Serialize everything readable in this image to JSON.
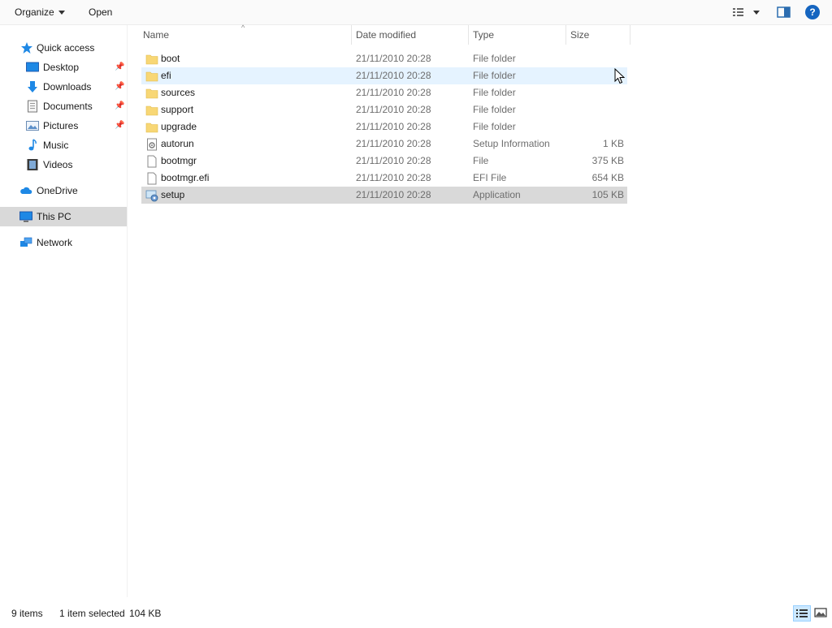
{
  "toolbar": {
    "organize": "Organize",
    "open": "Open",
    "help": "?"
  },
  "nav": {
    "quick_access": "Quick access",
    "items": [
      {
        "label": "Desktop",
        "icon": "desktop-icon",
        "pinned": true
      },
      {
        "label": "Downloads",
        "icon": "downloads-icon",
        "pinned": true
      },
      {
        "label": "Documents",
        "icon": "documents-icon",
        "pinned": true
      },
      {
        "label": "Pictures",
        "icon": "pictures-icon",
        "pinned": true
      },
      {
        "label": "Music",
        "icon": "music-icon",
        "pinned": false
      },
      {
        "label": "Videos",
        "icon": "videos-icon",
        "pinned": false
      }
    ],
    "onedrive": "OneDrive",
    "this_pc": "This PC",
    "network": "Network"
  },
  "columns": {
    "name": "Name",
    "date": "Date modified",
    "type": "Type",
    "size": "Size"
  },
  "files": [
    {
      "name": "boot",
      "date": "21/11/2010 20:28",
      "type": "File folder",
      "size": "",
      "icon": "folder-icon"
    },
    {
      "name": "efi",
      "date": "21/11/2010 20:28",
      "type": "File folder",
      "size": "",
      "icon": "folder-icon"
    },
    {
      "name": "sources",
      "date": "21/11/2010 20:28",
      "type": "File folder",
      "size": "",
      "icon": "folder-icon"
    },
    {
      "name": "support",
      "date": "21/11/2010 20:28",
      "type": "File folder",
      "size": "",
      "icon": "folder-icon"
    },
    {
      "name": "upgrade",
      "date": "21/11/2010 20:28",
      "type": "File folder",
      "size": "",
      "icon": "folder-icon"
    },
    {
      "name": "autorun",
      "date": "21/11/2010 20:28",
      "type": "Setup Information",
      "size": "1 KB",
      "icon": "settings-file-icon"
    },
    {
      "name": "bootmgr",
      "date": "21/11/2010 20:28",
      "type": "File",
      "size": "375 KB",
      "icon": "file-icon"
    },
    {
      "name": "bootmgr.efi",
      "date": "21/11/2010 20:28",
      "type": "EFI File",
      "size": "654 KB",
      "icon": "file-icon"
    },
    {
      "name": "setup",
      "date": "21/11/2010 20:28",
      "type": "Application",
      "size": "105 KB",
      "icon": "setup-app-icon"
    }
  ],
  "status": {
    "count": "9 items",
    "selected": "1 item selected",
    "size": "104 KB"
  },
  "colors": {
    "selection": "#d9d9d9",
    "hover": "#e5f3ff",
    "accent": "#0078d7",
    "folder": "#f8d775"
  }
}
